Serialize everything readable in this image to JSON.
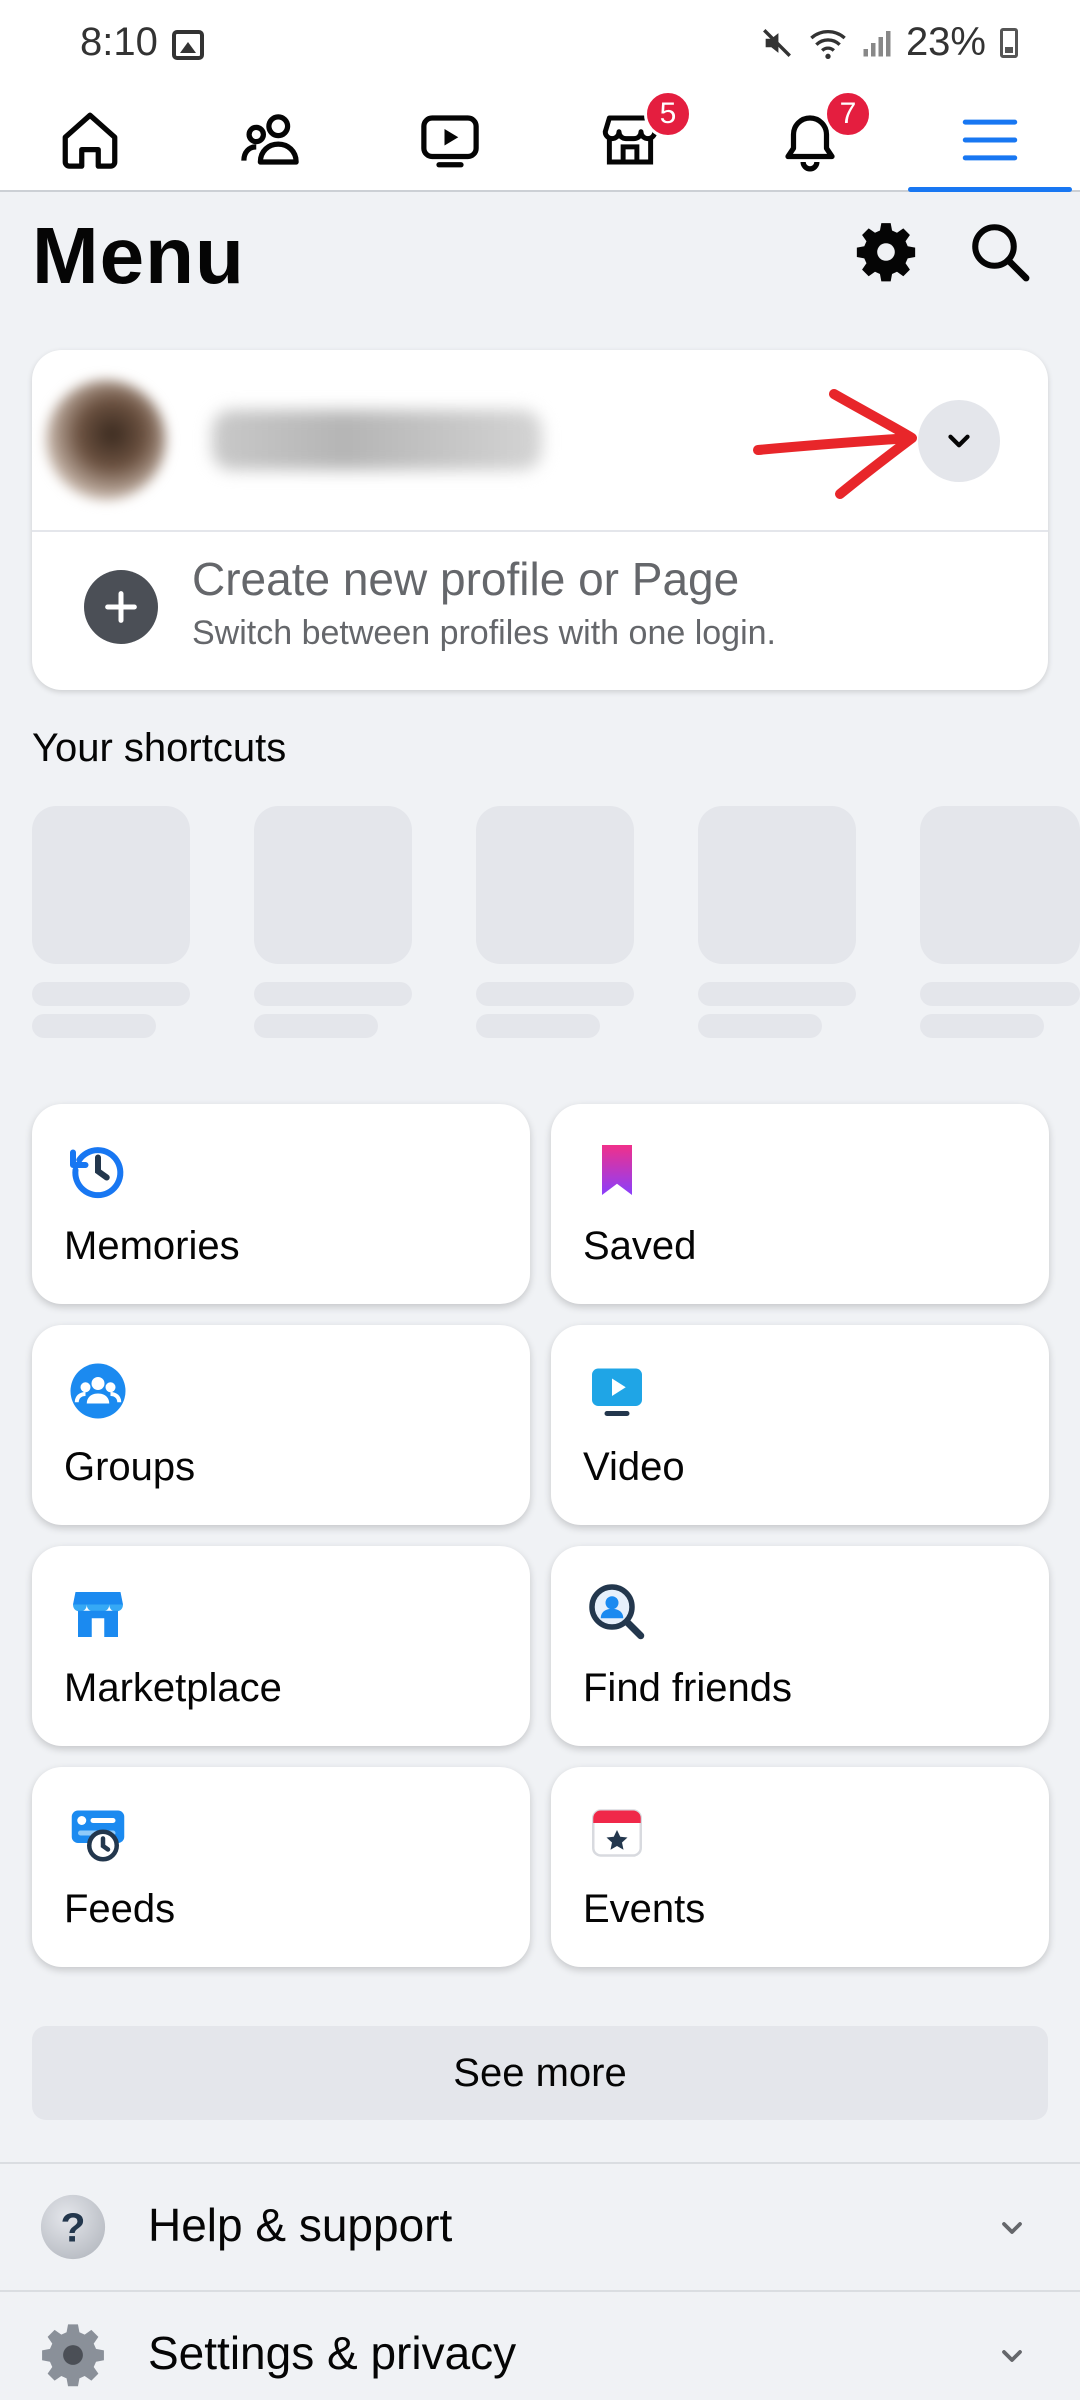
{
  "status_bar": {
    "time": "8:10",
    "battery": "23%"
  },
  "nav": {
    "items": [
      {
        "name": "home",
        "icon": "home-icon"
      },
      {
        "name": "friends",
        "icon": "friends-icon"
      },
      {
        "name": "video",
        "icon": "video-icon"
      },
      {
        "name": "marketplace",
        "icon": "marketplace-icon",
        "badge": "5"
      },
      {
        "name": "notifications",
        "icon": "bell-icon",
        "badge": "7"
      },
      {
        "name": "menu",
        "icon": "hamburger-icon",
        "active": true
      }
    ]
  },
  "header": {
    "title": "Menu"
  },
  "profile": {
    "create_title": "Create new profile or Page",
    "create_subtitle": "Switch between profiles with one login."
  },
  "shortcuts": {
    "label": "Your shortcuts"
  },
  "grid": [
    {
      "label": "Memories",
      "icon": "memories-icon"
    },
    {
      "label": "Saved",
      "icon": "saved-icon"
    },
    {
      "label": "Groups",
      "icon": "groups-icon"
    },
    {
      "label": "Video",
      "icon": "video-icon"
    },
    {
      "label": "Marketplace",
      "icon": "marketplace-icon"
    },
    {
      "label": "Find friends",
      "icon": "find-friends-icon"
    },
    {
      "label": "Feeds",
      "icon": "feeds-icon"
    },
    {
      "label": "Events",
      "icon": "events-icon"
    }
  ],
  "see_more": "See more",
  "sections": [
    {
      "label": "Help & support",
      "icon": "help-icon"
    },
    {
      "label": "Settings & privacy",
      "icon": "settings-icon"
    }
  ],
  "colors": {
    "accent": "#1877f2",
    "badge": "#e41e3f",
    "background": "#f0f2f5",
    "annotation_arrow": "#e8262a"
  }
}
